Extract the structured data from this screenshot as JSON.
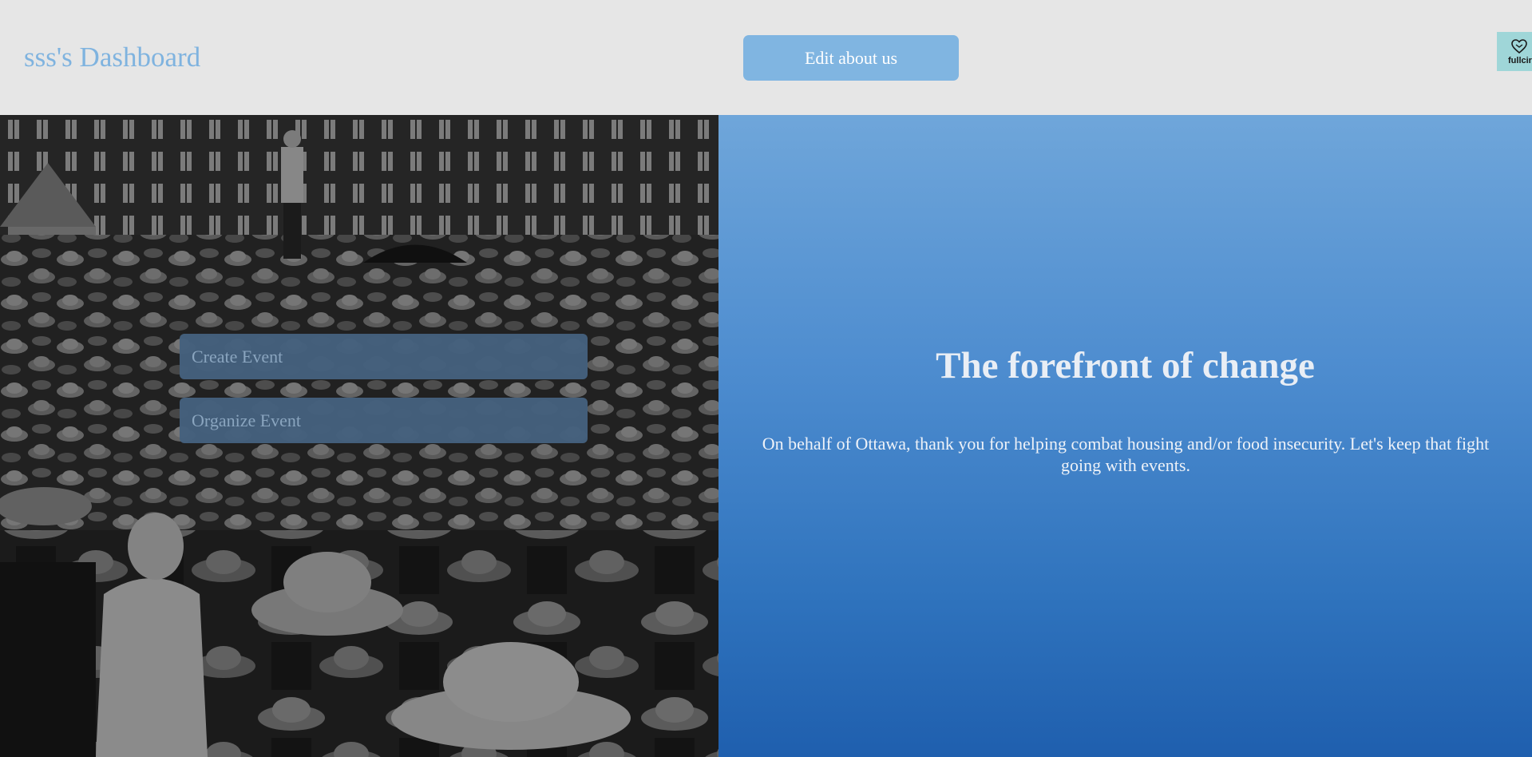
{
  "header": {
    "title": "sss's Dashboard",
    "edit_button_label": "Edit about us",
    "logo_text": "fullcir"
  },
  "actions": {
    "create_event": "Create Event",
    "organize_event": "Organize Event"
  },
  "hero": {
    "headline": "The forefront of change",
    "message": "On behalf of Ottawa, thank you for helping combat housing and/or food insecurity. Let's keep that fight going with events."
  },
  "colors": {
    "title_blue": "#7fb3df",
    "button_blue": "#80b5e1",
    "gradient_top": "#6fa6da",
    "gradient_bottom": "#1f5fae"
  }
}
